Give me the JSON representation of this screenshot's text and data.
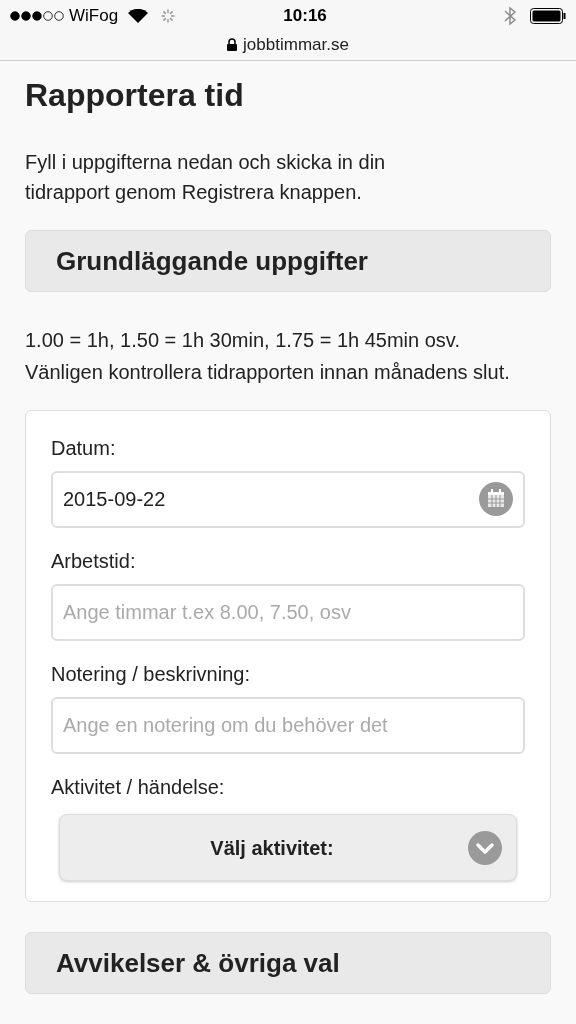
{
  "status_bar": {
    "carrier": "WiFog",
    "time": "10:16",
    "url": "jobbtimmar.se"
  },
  "title": "Rapportera tid",
  "intro": "Fyll i uppgifterna nedan och skicka in din tidrapport genom Registrera knappen.",
  "sections": [
    {
      "title": "Grundläggande uppgifter"
    }
  ],
  "note": "1.00 = 1h, 1.50 = 1h 30min, 1.75 = 1h 45min osv. Vänligen kontrollera tidrapporten innan månadens slut.",
  "fields": [
    {
      "kind": "date",
      "label": "Datum:",
      "value": "2015-09-22"
    },
    {
      "kind": "text",
      "label": "Arbetstid:",
      "placeholder": "Ange timmar t.ex 8.00, 7.50, osv"
    },
    {
      "kind": "text",
      "label": "Notering / beskrivning:",
      "placeholder": "Ange en notering om du behöver det"
    },
    {
      "kind": "select",
      "label": "Aktivitet / händelse:",
      "value": "Välj aktivitet:"
    }
  ],
  "bottom_section": {
    "title": "Avvikelser & övriga val"
  }
}
